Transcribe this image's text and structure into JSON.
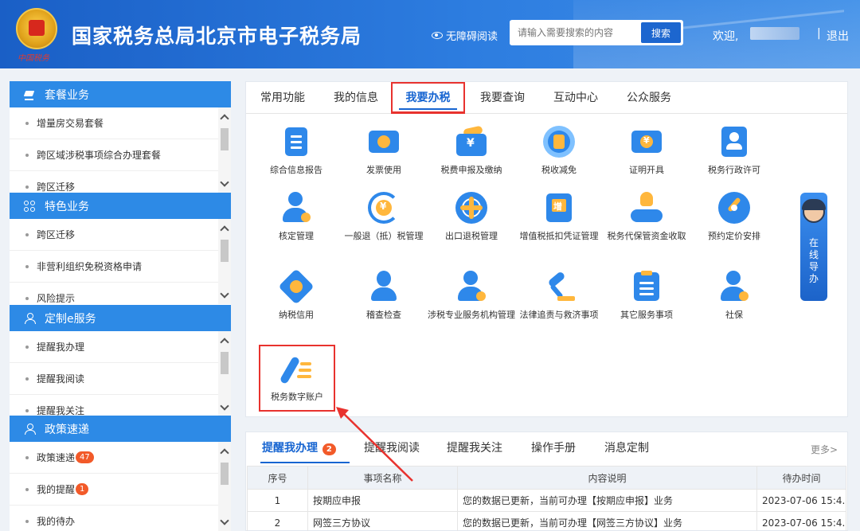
{
  "header": {
    "title": "国家税务总局北京市电子税务局",
    "emblem_text": "中国税务",
    "accessibility": "无障碍阅读",
    "search_placeholder": "请输入需要搜索的内容",
    "search_button": "搜索",
    "welcome": "欢迎,",
    "separator": "|",
    "logout": "退出"
  },
  "sidebar": {
    "panels": [
      {
        "title": "套餐业务",
        "icon": "layers-icon",
        "items": [
          "增量房交易套餐",
          "跨区域涉税事项综合办理套餐",
          "跨区迁移"
        ]
      },
      {
        "title": "特色业务",
        "icon": "grid-icon",
        "items": [
          "跨区迁移",
          "非营利组织免税资格申请",
          "风险提示"
        ]
      },
      {
        "title": "定制e服务",
        "icon": "user-icon",
        "items": [
          "提醒我办理",
          "提醒我阅读",
          "提醒我关注"
        ]
      },
      {
        "title": "政策速递",
        "icon": "user-icon",
        "items": [
          "政策速递",
          "我的提醒",
          "我的待办"
        ],
        "badges": [
          "47",
          "1",
          ""
        ]
      }
    ]
  },
  "tabs": [
    "常用功能",
    "我的信息",
    "我要办税",
    "我要查询",
    "互动中心",
    "公众服务"
  ],
  "functions": [
    {
      "label": "综合信息报告",
      "icon": "report-icon"
    },
    {
      "label": "发票使用",
      "icon": "invoice-icon"
    },
    {
      "label": "税费申报及缴纳",
      "icon": "tax-payment-icon"
    },
    {
      "label": "税收减免",
      "icon": "tax-relief-icon"
    },
    {
      "label": "证明开具",
      "icon": "certificate-icon"
    },
    {
      "label": "税务行政许可",
      "icon": "permit-icon"
    },
    {
      "label": "核定管理",
      "icon": "verification-icon"
    },
    {
      "label": "一般退（抵）税管理",
      "icon": "refund-icon"
    },
    {
      "label": "出口退税管理",
      "icon": "export-refund-icon"
    },
    {
      "label": "增值税抵扣凭证管理",
      "icon": "vat-voucher-icon"
    },
    {
      "label": "税务代保管资金收取",
      "icon": "custody-fund-icon"
    },
    {
      "label": "预约定价安排",
      "icon": "pricing-icon"
    },
    {
      "label": "纳税信用",
      "icon": "credit-icon"
    },
    {
      "label": "稽查检查",
      "icon": "inspection-icon"
    },
    {
      "label": "涉税专业服务机构管理",
      "icon": "agency-icon"
    },
    {
      "label": "法律追责与救济事项",
      "icon": "gavel-icon"
    },
    {
      "label": "其它服务事项",
      "icon": "other-service-icon"
    },
    {
      "label": "社保",
      "icon": "social-security-icon"
    },
    {
      "label": "税务数字账户",
      "icon": "digital-account-icon"
    }
  ],
  "guide": {
    "text": [
      "在",
      "线",
      "导",
      "办"
    ]
  },
  "messages": {
    "tabs": [
      "提醒我办理",
      "提醒我阅读",
      "提醒我关注",
      "操作手册",
      "消息定制"
    ],
    "tab_badge": "2",
    "more": "更多>",
    "columns": [
      "序号",
      "事项名称",
      "内容说明",
      "待办时间"
    ],
    "rows": [
      [
        "1",
        "按期应申报",
        "您的数据已更新，当前可办理【按期应申报】业务",
        "2023-07-06 15:4..."
      ],
      [
        "2",
        "网签三方协议",
        "您的数据已更新，当前可办理【网签三方协议】业务",
        "2023-07-06 15:4..."
      ]
    ]
  },
  "colors": {
    "brand": "#1a5fc6",
    "accent": "#2d8ae6",
    "highlight": "#e8322e",
    "icon_blue": "#2e88ea",
    "icon_orange": "#ffb73d"
  }
}
